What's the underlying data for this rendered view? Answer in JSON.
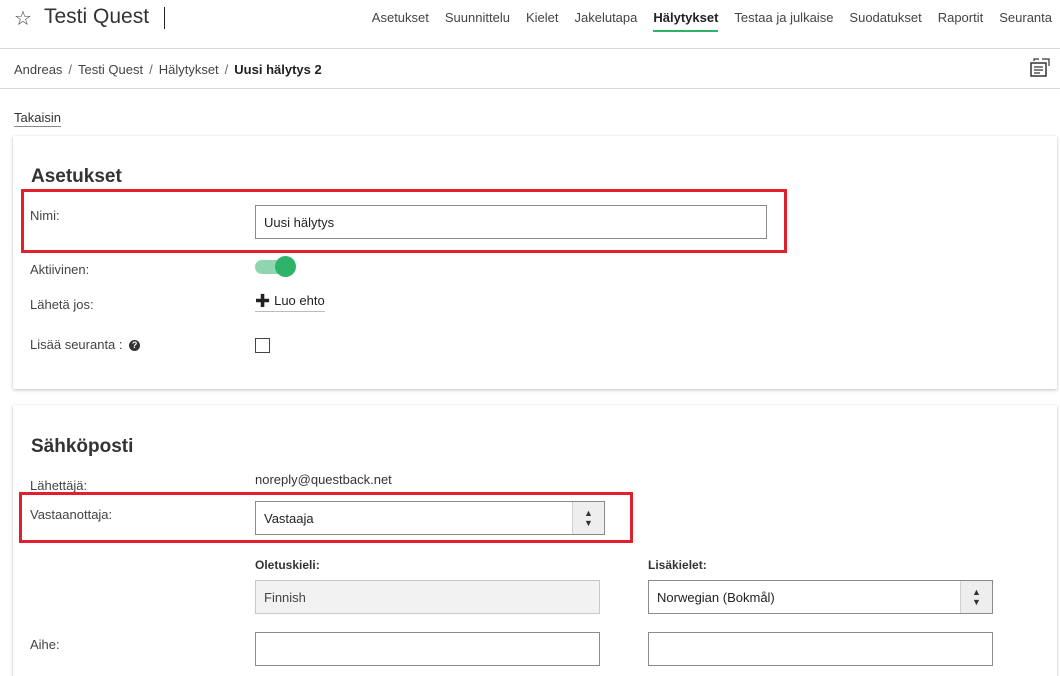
{
  "app": {
    "title": "Testi Quest"
  },
  "nav": {
    "items": [
      {
        "label": "Asetukset"
      },
      {
        "label": "Suunnittelu"
      },
      {
        "label": "Kielet"
      },
      {
        "label": "Jakelutapa"
      },
      {
        "label": "Hälytykset",
        "active": true
      },
      {
        "label": "Testaa ja julkaise"
      },
      {
        "label": "Suodatukset"
      },
      {
        "label": "Raportit"
      },
      {
        "label": "Seuranta"
      }
    ]
  },
  "breadcrumb": {
    "items": [
      "Andreas",
      "Testi Quest",
      "Hälytykset",
      "Uusi hälytys 2"
    ],
    "separator": "/"
  },
  "back": {
    "label": "Takaisin"
  },
  "settings": {
    "title": "Asetukset",
    "name_label": "Nimi:",
    "name_value": "Uusi hälytys",
    "active_label": "Aktiivinen:",
    "active_on": true,
    "send_if_label": "Lähetä jos:",
    "add_condition_label": "Luo ehto",
    "add_tracking_label": "Lisää seuranta :",
    "add_tracking_checked": false
  },
  "email": {
    "title": "Sähköposti",
    "sender_label": "Lähettäjä:",
    "sender_value": "noreply@questback.net",
    "recipient_label": "Vastaanottaja:",
    "recipient_value": "Vastaaja",
    "default_lang_label": "Oletuskieli:",
    "default_lang_value": "Finnish",
    "extra_lang_label": "Lisäkielet:",
    "extra_lang_value": "Norwegian (Bokmål)",
    "subject_label": "Aihe:",
    "subject_value": "",
    "subject_extra_value": ""
  },
  "colors": {
    "accent": "#2fb36b",
    "highlight": "#e0202c"
  },
  "icons": {
    "star": "star-icon",
    "translate": "translate-icon",
    "help": "help-icon",
    "plus": "plus-icon"
  }
}
